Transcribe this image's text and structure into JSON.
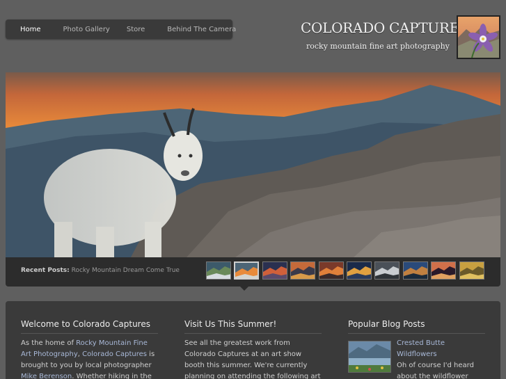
{
  "nav": {
    "items": [
      {
        "label": "Home"
      },
      {
        "label": "Photo Gallery"
      },
      {
        "label": "Store"
      },
      {
        "label": "Behind The Camera"
      }
    ]
  },
  "brand": {
    "title": "COLORADO CAPTURES",
    "subtitle": "rocky mountain fine art photography",
    "logo_icon": "columbine-flower-logo"
  },
  "recent": {
    "label": "Recent Posts:",
    "post": "Rocky Mountain Dream Come True",
    "thumbnail_count": 10,
    "active_thumbnail": 2
  },
  "columns": {
    "welcome": {
      "heading": "Welcome to Colorado Captures",
      "t1": "As the home of ",
      "l1": "Rocky Mountain Fine Art Photography",
      "t2": ", ",
      "l2": "Colorado Captures",
      "t3": " is brought to you by local photographer ",
      "l3": "Mike Berenson",
      "t4": ". Whether hiking in the"
    },
    "visit": {
      "heading": "Visit Us This Summer!",
      "text": "See all the greatest work from Colorado Captures at an art show booth this summer. We're currently planning on attending the following art shows in"
    },
    "popular": {
      "heading": "Popular Blog Posts",
      "link": "Crested Butte Wildflowers",
      "text": "Oh of course I'd heard about the wildflower festival in ..."
    }
  },
  "colors": {
    "background": "#5f5f5f",
    "panel": "#3a3a3a",
    "link": "#a9b9d8"
  }
}
